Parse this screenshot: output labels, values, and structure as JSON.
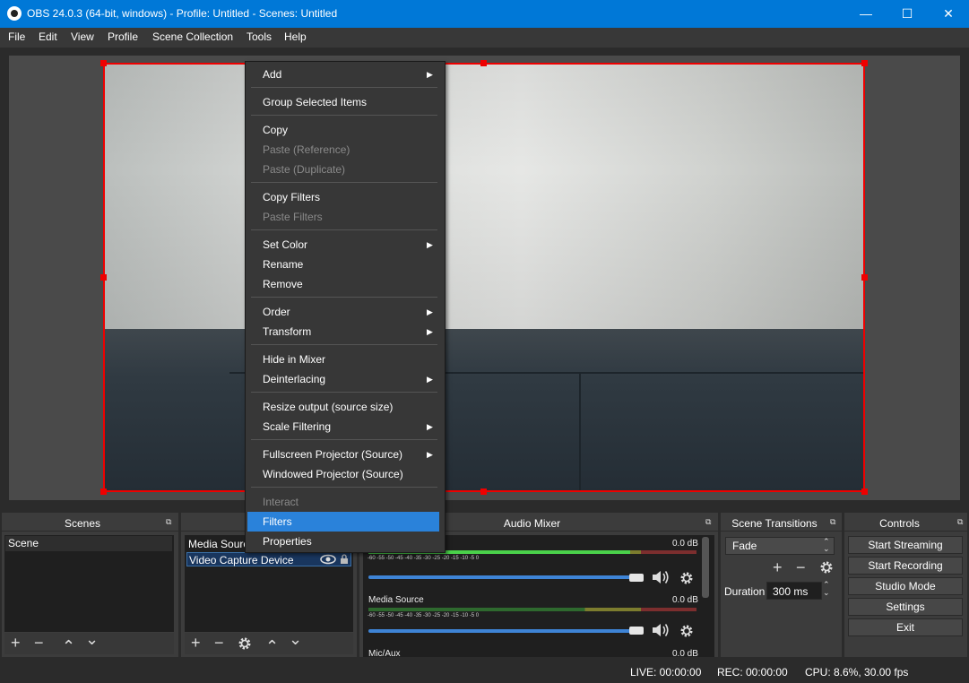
{
  "window": {
    "title": "OBS 24.0.3 (64-bit, windows) - Profile: Untitled - Scenes: Untitled",
    "minimize": "—",
    "maximize": "☐",
    "close": "✕"
  },
  "menubar": [
    "File",
    "Edit",
    "View",
    "Profile",
    "Scene Collection",
    "Tools",
    "Help"
  ],
  "context_menu": {
    "add": "Add",
    "group_selected": "Group Selected Items",
    "copy": "Copy",
    "paste_reference": "Paste (Reference)",
    "paste_duplicate": "Paste (Duplicate)",
    "copy_filters": "Copy Filters",
    "paste_filters": "Paste Filters",
    "set_color": "Set Color",
    "rename": "Rename",
    "remove": "Remove",
    "order": "Order",
    "transform": "Transform",
    "hide_in_mixer": "Hide in Mixer",
    "deinterlacing": "Deinterlacing",
    "resize_output": "Resize output (source size)",
    "scale_filtering": "Scale Filtering",
    "fullscreen_projector": "Fullscreen Projector (Source)",
    "windowed_projector": "Windowed Projector (Source)",
    "interact": "Interact",
    "filters": "Filters",
    "properties": "Properties",
    "arrow": "▶"
  },
  "docks": {
    "scenes": {
      "title": "Scenes",
      "items": [
        "Scene"
      ]
    },
    "sources": {
      "items": [
        "Media Source",
        "Video Capture Device"
      ]
    },
    "audio_mixer": {
      "title": "Audio Mixer",
      "channels": [
        {
          "name": "",
          "db": "0.0 dB",
          "volume": 1.0
        },
        {
          "name": "Media Source",
          "db": "0.0 dB",
          "volume": 1.0
        },
        {
          "name": "Mic/Aux",
          "db": "0.0 dB",
          "volume": 1.0
        }
      ],
      "ticks": "-60 -55 -50 -45 -40 -35 -30 -25 -20 -15 -10 -5 0"
    },
    "scene_transitions": {
      "title": "Scene Transitions",
      "transition": "Fade",
      "duration_label": "Duration",
      "duration_value": "300 ms"
    },
    "controls": {
      "title": "Controls",
      "start_streaming": "Start Streaming",
      "start_recording": "Start Recording",
      "studio_mode": "Studio Mode",
      "settings": "Settings",
      "exit": "Exit"
    },
    "float_icon": "⧉"
  },
  "toolbar_icons": {
    "add": "+",
    "remove": "−",
    "up": "⌃",
    "down": "⌄"
  },
  "status": {
    "live": "LIVE: 00:00:00",
    "rec": "REC: 00:00:00",
    "cpu": "CPU: 8.6%, 30.00 fps"
  },
  "colors": {
    "accent": "#0078d7",
    "selection": "#2a82da",
    "source_bounds": "#ee0000",
    "background": "#2b2b2b"
  }
}
